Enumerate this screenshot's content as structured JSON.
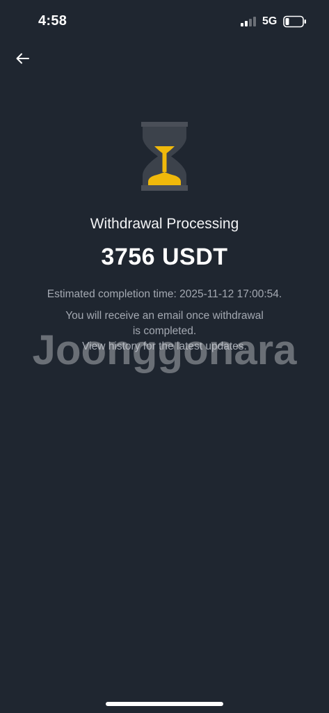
{
  "status_bar": {
    "time": "4:58",
    "network": "5G",
    "signal_icon": "signal-bars-icon",
    "battery_icon": "battery-icon"
  },
  "nav": {
    "back_icon": "arrow-left-icon"
  },
  "withdrawal": {
    "icon": "hourglass-icon",
    "title": "Withdrawal Processing",
    "amount": "3756 USDT",
    "eta": "Estimated completion time: 2025-11-12 17:00:54.",
    "info_lines": [
      "You will receive an email once withdrawal",
      "is completed.",
      "View history for the latest updates."
    ]
  },
  "watermark": "Joonggonara",
  "colors": {
    "background": "#1f2630",
    "accent": "#f0b90b",
    "secondary_text": "#a4a9b2"
  }
}
